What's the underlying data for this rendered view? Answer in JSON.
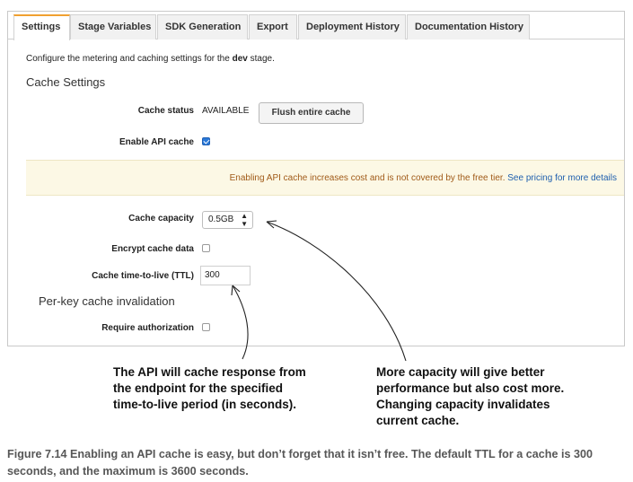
{
  "tabs": [
    {
      "label": "Settings",
      "active": true
    },
    {
      "label": "Stage Variables",
      "active": false
    },
    {
      "label": "SDK Generation",
      "active": false
    },
    {
      "label": "Export",
      "active": false
    },
    {
      "label": "Deployment History",
      "active": false
    },
    {
      "label": "Documentation History",
      "active": false
    }
  ],
  "intro": {
    "prefix": "Configure the metering and caching settings for the ",
    "stage": "dev",
    "suffix": " stage."
  },
  "cache_settings": {
    "title": "Cache Settings",
    "status_label": "Cache status",
    "status_value": "AVAILABLE",
    "flush_button": "Flush entire cache",
    "enable_label": "Enable API cache",
    "enable_checked": true,
    "notice_text": "Enabling API cache increases cost and is not covered by the free tier.",
    "notice_link": "See pricing for more details",
    "capacity_label": "Cache capacity",
    "capacity_value": "0.5GB",
    "encrypt_label": "Encrypt cache data",
    "encrypt_checked": false,
    "ttl_label": "Cache time-to-live (TTL)",
    "ttl_value": "300"
  },
  "per_key": {
    "title": "Per-key cache invalidation",
    "require_label": "Require authorization",
    "require_checked": false
  },
  "callouts": {
    "ttl": "The API will cache response from\nthe endpoint for the specified\ntime-to-live period (in seconds).",
    "capacity": "More capacity will give better\nperformance but also cost more.\nChanging capacity invalidates\ncurrent cache."
  },
  "caption": "Figure 7.14    Enabling an API cache is easy, but don’t forget that it isn’t free. The default TTL for a cache is 300 seconds, and the maximum is 3600 seconds.",
  "colors": {
    "accent_tab": "#f0a030",
    "link": "#1f5fae",
    "warning_text": "#a05a18",
    "notice_bg": "#fcf8e5"
  }
}
